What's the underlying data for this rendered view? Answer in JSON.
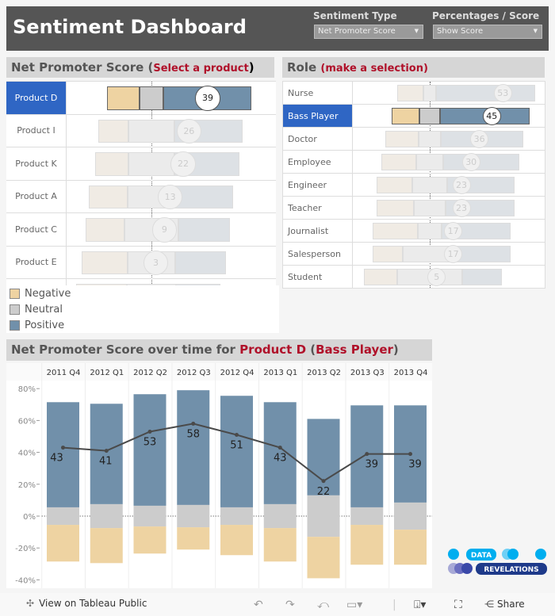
{
  "header": {
    "title": "Sentiment Dashboard",
    "sentiment_type": {
      "label": "Sentiment Type",
      "value": "Net Promoter Score"
    },
    "pct_score": {
      "label": "Percentages / Score",
      "value": "Show Score"
    }
  },
  "colors": {
    "negative": "#eed3a2",
    "neutral": "#cccccc",
    "positive": "#7190aa",
    "selected": "#2f66c4",
    "accent": "#b0112a"
  },
  "products": {
    "title": "Net Promoter Score (",
    "hint": "Select a product",
    "close": ")",
    "rows": [
      {
        "label": "Product D",
        "neg": 22,
        "neu": 17,
        "pos": 61,
        "score": "39",
        "selected": true
      },
      {
        "label": "Product I",
        "neg": 21,
        "neu": 32,
        "pos": 47,
        "score": "26"
      },
      {
        "label": "Product K",
        "neg": 23,
        "neu": 32,
        "pos": 45,
        "score": "22"
      },
      {
        "label": "Product A",
        "neg": 27,
        "neu": 33,
        "pos": 40,
        "score": "13"
      },
      {
        "label": "Product C",
        "neg": 27,
        "neu": 37,
        "pos": 36,
        "score": "9"
      },
      {
        "label": "Product E",
        "neg": 32,
        "neu": 33,
        "pos": 35,
        "score": "3"
      },
      {
        "label": "",
        "neg": 35,
        "neu": 34,
        "pos": 31,
        "score": ""
      }
    ]
  },
  "legend": [
    {
      "label": "Negative",
      "key": "negative"
    },
    {
      "label": "Neutral",
      "key": "neutral"
    },
    {
      "label": "Positive",
      "key": "positive"
    }
  ],
  "roles": {
    "title": "Role",
    "hint": "(make a selection)",
    "rows": [
      {
        "label": "Nurse",
        "neg": 19,
        "neu": 9,
        "pos": 72,
        "score": "53"
      },
      {
        "label": "Bass Player",
        "neg": 20,
        "neu": 15,
        "pos": 65,
        "score": "45",
        "selected": true
      },
      {
        "label": "Doctor",
        "neg": 24,
        "neu": 16,
        "pos": 60,
        "score": "36"
      },
      {
        "label": "Employee",
        "neg": 25,
        "neu": 20,
        "pos": 55,
        "score": "30"
      },
      {
        "label": "Engineer",
        "neg": 26,
        "neu": 25,
        "pos": 49,
        "score": "23"
      },
      {
        "label": "Teacher",
        "neg": 27,
        "neu": 23,
        "pos": 50,
        "score": "23"
      },
      {
        "label": "Journalist",
        "neg": 33,
        "neu": 17,
        "pos": 50,
        "score": "17"
      },
      {
        "label": "Salesperson",
        "neg": 22,
        "neu": 39,
        "pos": 39,
        "score": "17"
      },
      {
        "label": "Student",
        "neg": 24,
        "neu": 47,
        "pos": 29,
        "score": "5"
      }
    ]
  },
  "chart_title": {
    "prefix": "Net Promoter Score over time for ",
    "product": "Product D",
    "open": " (",
    "role": "Bass Player",
    "close": ")"
  },
  "chart_data": {
    "type": "bar",
    "categories": [
      "2011 Q4",
      "2012 Q1",
      "2012 Q2",
      "2012 Q3",
      "2012 Q4",
      "2013 Q1",
      "2013 Q2",
      "2013 Q3",
      "2013 Q4"
    ],
    "series": [
      {
        "name": "Positive",
        "values": [
          66,
          63,
          70,
          72,
          70,
          64,
          48,
          64,
          61
        ]
      },
      {
        "name": "Neutral",
        "values": [
          11,
          15,
          13,
          14,
          11,
          15,
          26,
          11,
          17
        ]
      },
      {
        "name": "Negative",
        "values": [
          23,
          22,
          17,
          14,
          19,
          21,
          26,
          25,
          22
        ]
      }
    ],
    "line": {
      "values": [
        43,
        41,
        53,
        58,
        51,
        43,
        22,
        39,
        39
      ]
    },
    "yticks": [
      "80%",
      "60%",
      "40%",
      "20%",
      "0%",
      "-20%",
      "-40%"
    ],
    "ylim": [
      -40,
      80
    ]
  },
  "logo": {
    "line1": "DATA",
    "line2": "REVELATIONS"
  },
  "footer": {
    "view": "View on Tableau Public",
    "share": "Share"
  }
}
